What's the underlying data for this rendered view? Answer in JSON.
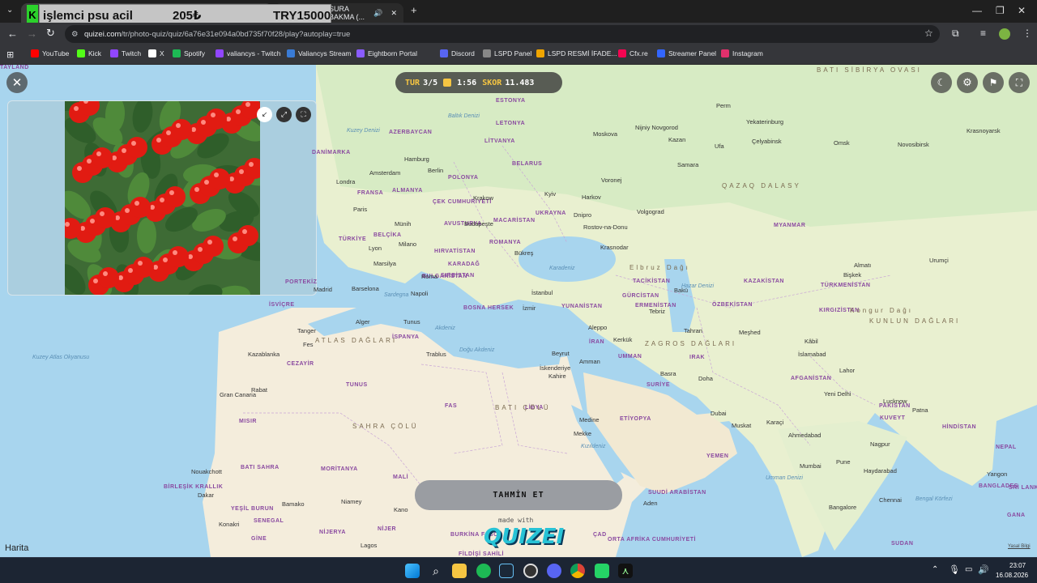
{
  "browser": {
    "tabs": [
      {
        "label": "işlemci psu acil"
      },
      {
        "label": "SURA BAKMA (..."
      }
    ],
    "overlay": {
      "item": "işlemci psu acil",
      "price": "205₺",
      "budget": "TRY15000"
    },
    "url": {
      "host": "quizei.com",
      "path": "/tr/photo-quiz/quiz/6a76e31e094a0bd735f70f28/play?autoplay=true"
    },
    "bookmarks": [
      {
        "label": "YouTube",
        "color": "#ff0000"
      },
      {
        "label": "Kick",
        "color": "#53fc18"
      },
      {
        "label": "Twitch",
        "color": "#9146ff"
      },
      {
        "label": "X",
        "color": "#ffffff"
      },
      {
        "label": "Spotify",
        "color": "#1db954"
      },
      {
        "label": "valiancys - Twitch",
        "color": "#9146ff"
      },
      {
        "label": "Valiancys Stream",
        "color": "#3a7bd5"
      },
      {
        "label": "Eightborn Portal",
        "color": "#8a5cff"
      },
      {
        "label": "Discord",
        "color": "#5865f2"
      },
      {
        "label": "LSPD Panel",
        "color": "#888888"
      },
      {
        "label": "LSPD  RESMİ İFADE...",
        "color": "#f0a500"
      },
      {
        "label": "Cfx.re",
        "color": "#f40552"
      },
      {
        "label": "Streamer Panel",
        "color": "#3366ff"
      },
      {
        "label": "Instagram",
        "color": "#e1306c"
      }
    ]
  },
  "quiz": {
    "round_label": "TUR",
    "round": "3/5",
    "timer": "1:56",
    "score_label": "SKOR",
    "score": "11.483",
    "guess_button": "TAHMİN ET",
    "made_with": "made with",
    "brand": "QUIZEI",
    "map_attribution": "Harita",
    "legal": "Yasal Bilgi"
  },
  "map_labels": {
    "countries": [
      "ESTONYA",
      "LETONYA",
      "LİTVANYA",
      "BELARUS",
      "POLONYA",
      "ALMANYA",
      "ÇEK CUMHURİYETİ",
      "AVUSTURYA",
      "MACARİSTAN",
      "UKRAYNA",
      "ROMANYA",
      "BULGARİSTAN",
      "SIRBİSTAN",
      "KARADAĞ",
      "HIRVATİSTAN",
      "BOSNA HERSEK",
      "YUNANİSTAN",
      "TÜRKİYE",
      "FRANSA",
      "BELÇİKA",
      "İSVİÇRE",
      "PORTEKİZ",
      "İSPANYA",
      "TUNUS",
      "CEZAYİR",
      "FAS",
      "LİBYA",
      "MISIR",
      "BATI SAHRA",
      "MORİTANYA",
      "MALİ",
      "NİJER",
      "NİJERYA",
      "BURKİNA FASO",
      "ÇAD",
      "ETİYOPYA",
      "SUUDİ ARABİSTAN",
      "YEMEN",
      "UMMAN",
      "IRAK",
      "İRAN",
      "SURİYE",
      "KUVEYT",
      "AFGANİSTAN",
      "PAKİSTAN",
      "HİNDİSTAN",
      "NEPAL",
      "BANGLADEŞ",
      "MYANMAR",
      "KAZAKİSTAN",
      "ÖZBEKİSTAN",
      "TÜRKMENİSTAN",
      "KIRGIZİSTAN",
      "TACİKİSTAN",
      "GÜRCİSTAN",
      "ERMENİSTAN",
      "AZERBAYCAN",
      "DANİMARKA",
      "BİRLEŞİK KRALLIK",
      "YEŞİL BURUN",
      "SENEGAL",
      "GİNE",
      "FİLDİŞİ SAHİLİ",
      "GANA",
      "ORTA AFRİKA CUMHURİYETİ",
      "SUDAN",
      "SRİ LANKA",
      "TAYLAND"
    ],
    "cities": [
      "Moskova",
      "Nijniy Novgorod",
      "Perm",
      "Yekaterinburg",
      "Krasnoyarsk",
      "Kazan",
      "Ufa",
      "Çelyabinsk",
      "Omsk",
      "Novosibirsk",
      "Samara",
      "Voronej",
      "Volgograd",
      "Rostov-na-Donu",
      "Krasnodar",
      "Harkov",
      "Dnipro",
      "Kyiv",
      "Hamburg",
      "Berlin",
      "Amsterdam",
      "Londra",
      "Paris",
      "Krakow",
      "Münih",
      "Budapeşte",
      "Milano",
      "Lyon",
      "Marsilya",
      "Roma",
      "Napoli",
      "Barselona",
      "Madrid",
      "Bükreş",
      "İstanbul",
      "İzmir",
      "Tebriz",
      "Bakü",
      "Tahran",
      "Meşhed",
      "Kâbil",
      "İslamabad",
      "Lahor",
      "Yeni Delhi",
      "Lucknow",
      "Patna",
      "Ahmedabad",
      "Nagpur",
      "Mumbai",
      "Pune",
      "Haydarabad",
      "Bangalore",
      "Chennai",
      "Almatı",
      "Bişkek",
      "Urumçi",
      "Aleppo",
      "Kerkük",
      "Beyrut",
      "Amman",
      "İskenderiye",
      "Kahire",
      "Basra",
      "Dubai",
      "Muskat",
      "Karaçi",
      "Medine",
      "Aden",
      "Tunus",
      "Alger",
      "Tanger",
      "Fes",
      "Kazablanka",
      "Trablus",
      "Nouakchott",
      "Dakar",
      "Bamako",
      "Niamey",
      "Kano",
      "Konakri",
      "Lagos",
      "Yangon",
      "Rabat",
      "Gran Canaria",
      "Mekke",
      "Doha"
    ],
    "seas": [
      "Baltık Denizi",
      "Kuzey Denizi",
      "Karadeniz",
      "Akdeniz",
      "Doğu Akdeniz",
      "Hazar Denizi",
      "Kızıldeniz",
      "Kuzey Atlas Okyanusu",
      "Umman Denizi",
      "Bengal Körfezi",
      "Sardegna"
    ],
    "ranges": [
      "BATI SİBİRYA OVASI",
      "QAZAQ DALASY",
      "KUNLUN DAĞLARI",
      "ATLAS DAĞLARI",
      "SAHRA ÇÖLÜ",
      "ZAGROS DAĞLARI",
      "BATI ÇÖLÜ",
      "Elbruz Dağı",
      "Kongur Dağı"
    ]
  },
  "taskbar": {
    "time": "23:07",
    "date": "16.08.2026"
  },
  "colors": {
    "land": "#eef1d6",
    "sea": "#a8d5ee",
    "desert": "#f4eddc",
    "forest": "#cfe6b8",
    "accent": "#27c3d6"
  }
}
